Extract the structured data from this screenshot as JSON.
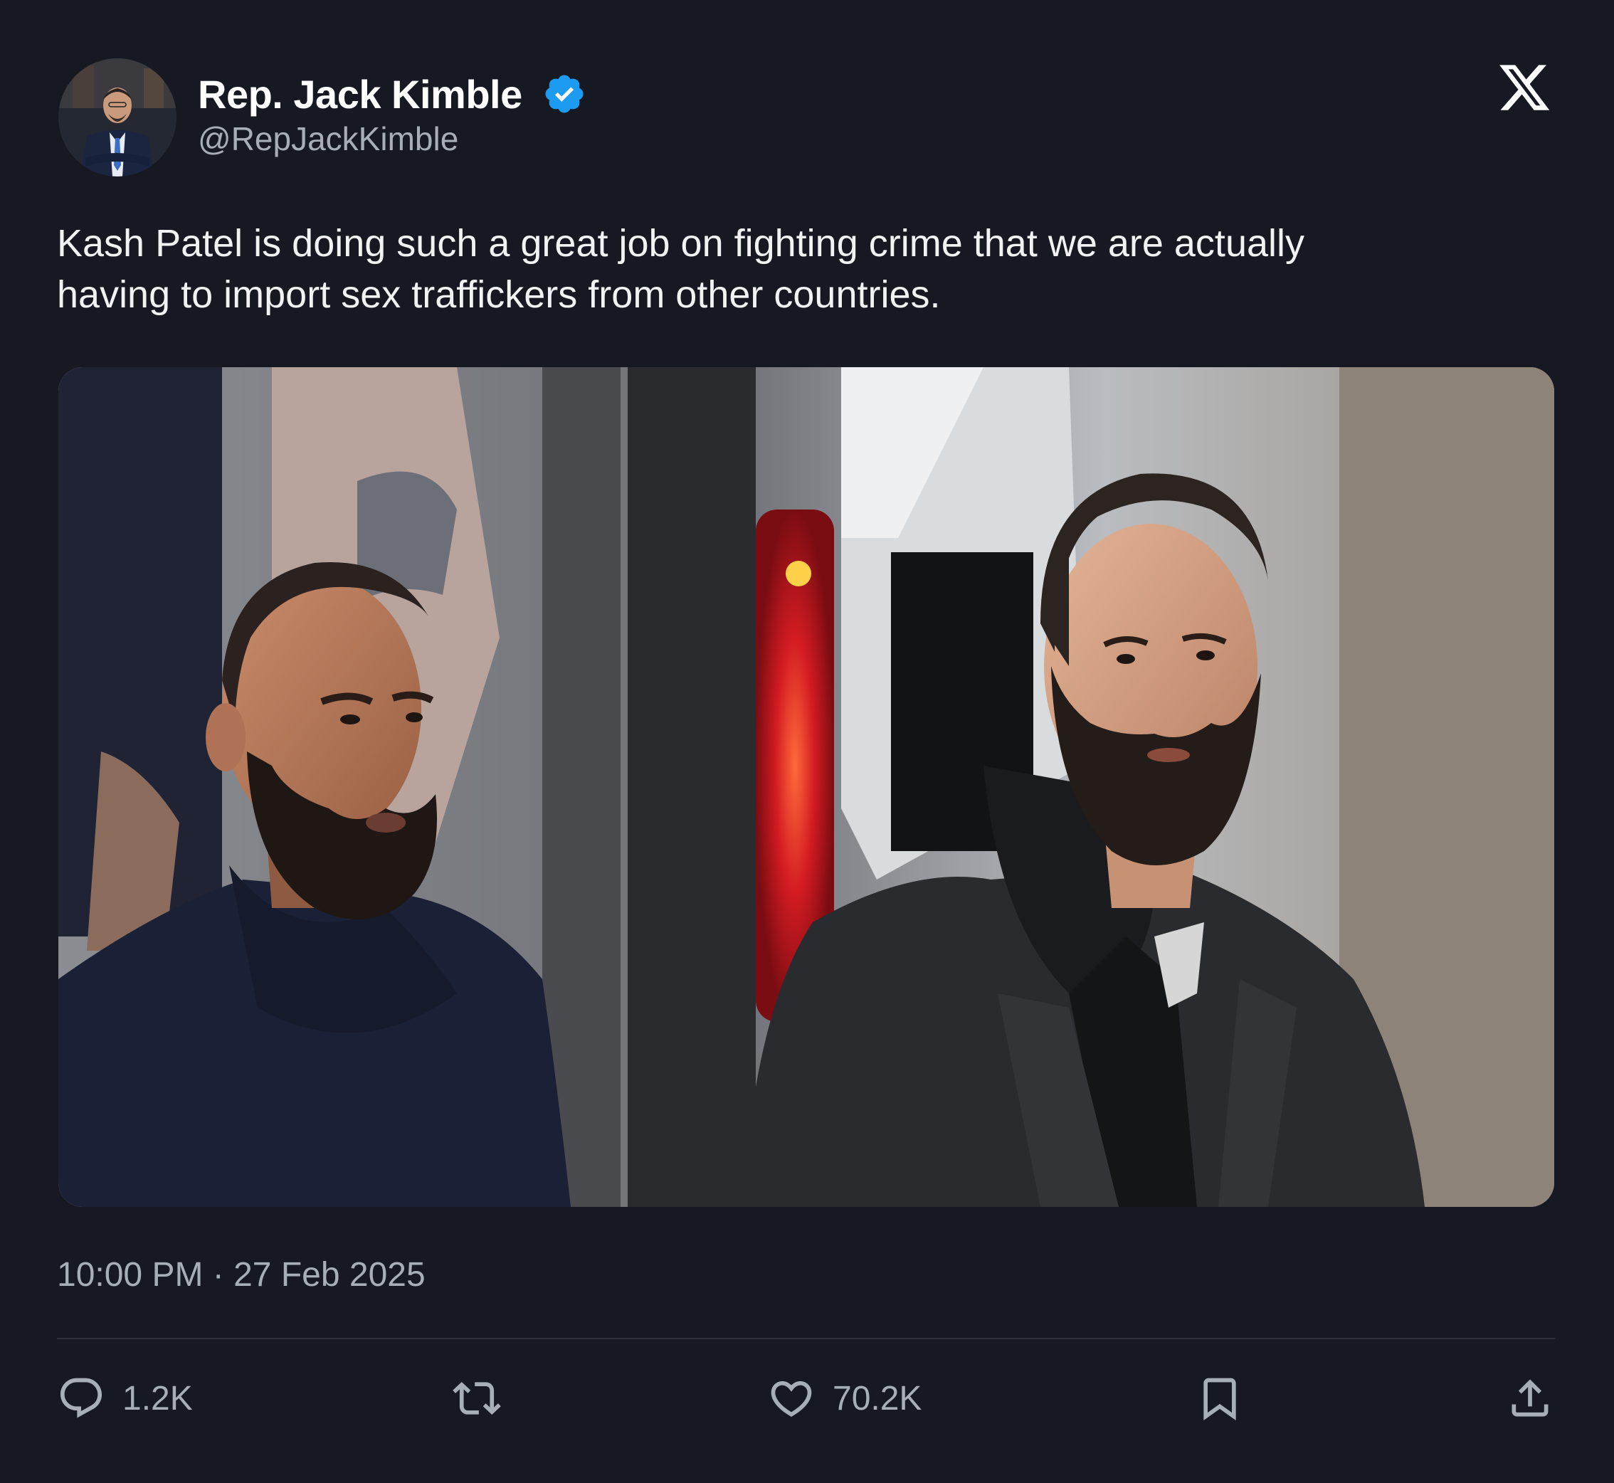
{
  "author": {
    "display_name": "Rep. Jack Kimble",
    "handle": "@RepJackKimble",
    "verified": true,
    "verified_color": "#1d9bf0"
  },
  "platform_icon": "x-logo-icon",
  "tweet": {
    "text": "Kash Patel is doing such a great job on fighting crime that we are actually\nhaving to import sex traffickers from other countries.",
    "timestamp": "10:00 PM · 27 Feb 2025"
  },
  "media": {
    "kind": "photo",
    "icon": "photo-of-two-bearded-men"
  },
  "actions": {
    "reply": {
      "icon": "reply-icon",
      "count": "1.2K"
    },
    "retweet": {
      "icon": "retweet-icon",
      "count": ""
    },
    "like": {
      "icon": "heart-icon",
      "count": "70.2K"
    },
    "bookmark": {
      "icon": "bookmark-icon",
      "count": ""
    },
    "share": {
      "icon": "share-icon",
      "count": ""
    }
  },
  "colors": {
    "background": "#161922",
    "primary_text": "#ffffff",
    "secondary_text": "#a7aeb6",
    "divider": "#2a2e36"
  }
}
